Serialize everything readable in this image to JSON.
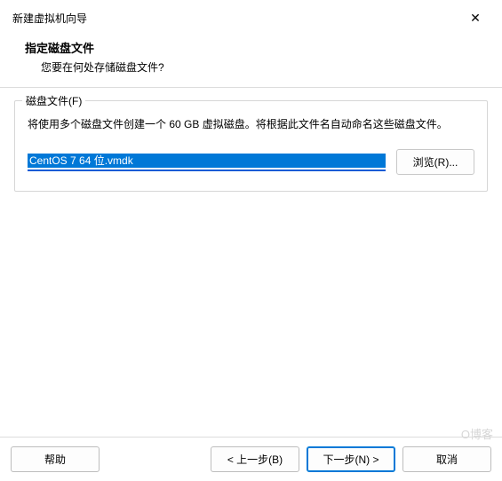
{
  "window": {
    "title": "新建虚拟机向导"
  },
  "header": {
    "title": "指定磁盘文件",
    "subtitle": "您要在何处存储磁盘文件?"
  },
  "group": {
    "legend": "磁盘文件(F)",
    "description": "将使用多个磁盘文件创建一个 60 GB 虚拟磁盘。将根据此文件名自动命名这些磁盘文件。",
    "file_value": "CentOS 7 64 位.vmdk",
    "browse_label": "浏览(R)..."
  },
  "footer": {
    "help": "帮助",
    "back": "< 上一步(B)",
    "next": "下一步(N) >",
    "cancel": "取消"
  },
  "watermark": "O博客"
}
